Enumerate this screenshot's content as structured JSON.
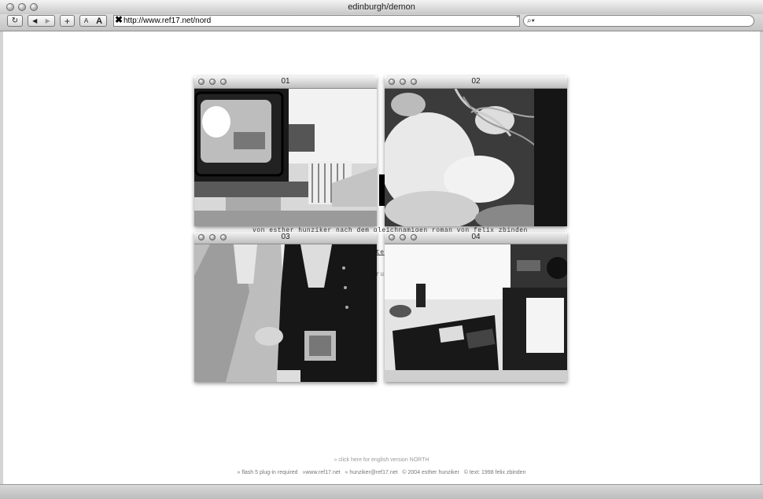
{
  "window": {
    "title": "edinburgh/demon"
  },
  "toolbar": {
    "url": "http://www.ref17.net/nord",
    "search_value": "",
    "text_smaller": "A",
    "text_larger": "A",
    "add_label": "+"
  },
  "page": {
    "credit_line": "von esther hunziker nach dem gleichnamigen roman von felix zbinden",
    "hidden_link_fragment": "te",
    "hidden_text_fragment": "ruc",
    "english_link": "» click here for english version NORTH",
    "footer": {
      "flash": "» flash 5 plug-in required",
      "site": "»www.ref17.net",
      "email": "» hunziker@ref17.net",
      "copyright": "© 2004 esther hunziker",
      "text_credit": "© text: 1998 felix zbinden"
    }
  },
  "popups": [
    {
      "label": "01",
      "image": "tv-room-photo"
    },
    {
      "label": "02",
      "image": "blurred-plant-photo"
    },
    {
      "label": "03",
      "image": "handshake-photo"
    },
    {
      "label": "04",
      "image": "electronics-desk-photo"
    }
  ]
}
